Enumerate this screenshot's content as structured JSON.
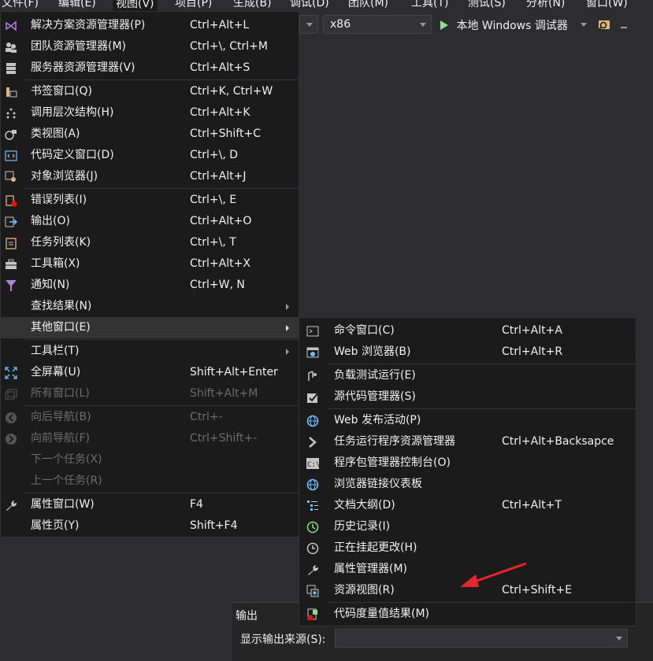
{
  "menubar": {
    "items": [
      "文件(F)",
      "编辑(E)",
      "视图(V)",
      "项目(P)",
      "生成(B)",
      "调试(D)",
      "团队(M)",
      "工具(T)",
      "测试(S)",
      "分析(N)",
      "窗口(W)"
    ]
  },
  "toolbar": {
    "config_value": "",
    "platform_value": "x86",
    "debug_label": "本地 Windows 调试器"
  },
  "view_menu": {
    "items": [
      {
        "label": "解决方案资源管理器(P)",
        "shortcut": "Ctrl+Alt+L",
        "icon": "solution-explorer-icon"
      },
      {
        "label": "团队资源管理器(M)",
        "shortcut": "Ctrl+\\, Ctrl+M",
        "icon": "team-explorer-icon"
      },
      {
        "label": "服务器资源管理器(V)",
        "shortcut": "Ctrl+Alt+S",
        "icon": "server-explorer-icon"
      },
      {
        "label": "书签窗口(Q)",
        "shortcut": "Ctrl+K, Ctrl+W",
        "icon": "bookmark-icon"
      },
      {
        "label": "调用层次结构(H)",
        "shortcut": "Ctrl+Alt+K",
        "icon": "call-hierarchy-icon"
      },
      {
        "label": "类视图(A)",
        "shortcut": "Ctrl+Shift+C",
        "icon": "class-view-icon"
      },
      {
        "label": "代码定义窗口(D)",
        "shortcut": "Ctrl+\\, D",
        "icon": "code-definition-icon"
      },
      {
        "label": "对象浏览器(J)",
        "shortcut": "Ctrl+Alt+J",
        "icon": "object-browser-icon"
      },
      {
        "label": "错误列表(I)",
        "shortcut": "Ctrl+\\, E",
        "icon": "error-list-icon"
      },
      {
        "label": "输出(O)",
        "shortcut": "Ctrl+Alt+O",
        "icon": "output-icon"
      },
      {
        "label": "任务列表(K)",
        "shortcut": "Ctrl+\\, T",
        "icon": "task-list-icon"
      },
      {
        "label": "工具箱(X)",
        "shortcut": "Ctrl+Alt+X",
        "icon": "toolbox-icon"
      },
      {
        "label": "通知(N)",
        "shortcut": "Ctrl+W, N",
        "icon": "notification-icon"
      },
      {
        "label": "查找结果(N)",
        "shortcut": "",
        "icon": ""
      },
      {
        "label": "其他窗口(E)",
        "shortcut": "",
        "icon": ""
      },
      {
        "label": "工具栏(T)",
        "shortcut": "",
        "icon": ""
      },
      {
        "label": "全屏幕(U)",
        "shortcut": "Shift+Alt+Enter",
        "icon": "fullscreen-icon"
      },
      {
        "label": "所有窗口(L)",
        "shortcut": "Shift+Alt+M",
        "icon": "all-windows-icon"
      },
      {
        "label": "向后导航(B)",
        "shortcut": "Ctrl+-",
        "icon": "navigate-back-icon"
      },
      {
        "label": "向前导航(F)",
        "shortcut": "Ctrl+Shift+-",
        "icon": "navigate-forward-icon"
      },
      {
        "label": "下一个任务(X)",
        "shortcut": "",
        "icon": ""
      },
      {
        "label": "上一个任务(R)",
        "shortcut": "",
        "icon": ""
      },
      {
        "label": "属性窗口(W)",
        "shortcut": "F4",
        "icon": "wrench-icon"
      },
      {
        "label": "属性页(Y)",
        "shortcut": "Shift+F4",
        "icon": ""
      }
    ]
  },
  "other_windows_menu": {
    "items": [
      {
        "label": "命令窗口(C)",
        "shortcut": "Ctrl+Alt+A",
        "icon": "command-window-icon"
      },
      {
        "label": "Web 浏览器(B)",
        "shortcut": "Ctrl+Alt+R",
        "icon": "web-browser-icon"
      },
      {
        "label": "负载测试运行(E)",
        "shortcut": "",
        "icon": "load-test-icon"
      },
      {
        "label": "源代码管理器(S)",
        "shortcut": "",
        "icon": "source-control-icon"
      },
      {
        "label": "Web 发布活动(P)",
        "shortcut": "",
        "icon": "web-publish-icon"
      },
      {
        "label": "任务运行程序资源管理器",
        "shortcut": "Ctrl+Alt+Backsapce",
        "icon": "task-runner-icon"
      },
      {
        "label": "程序包管理器控制台(O)",
        "shortcut": "",
        "icon": "package-manager-icon"
      },
      {
        "label": "浏览器链接仪表板",
        "shortcut": "",
        "icon": "browser-link-icon"
      },
      {
        "label": "文档大纲(D)",
        "shortcut": "Ctrl+Alt+T",
        "icon": "document-outline-icon"
      },
      {
        "label": "历史记录(I)",
        "shortcut": "",
        "icon": "history-icon"
      },
      {
        "label": "正在挂起更改(H)",
        "shortcut": "",
        "icon": "pending-changes-icon"
      },
      {
        "label": "属性管理器(M)",
        "shortcut": "",
        "icon": "property-manager-icon"
      },
      {
        "label": "资源视图(R)",
        "shortcut": "Ctrl+Shift+E",
        "icon": "resource-view-icon"
      },
      {
        "label": "代码度量值结果(M)",
        "shortcut": "",
        "icon": "code-metrics-icon"
      }
    ]
  },
  "output_panel": {
    "title": "输出",
    "source_label": "显示输出来源(S):",
    "source_value": ""
  },
  "colors": {
    "menu_bg": "#1b1b1c",
    "highlight": "#333334",
    "text": "#f1f1f1",
    "disabled": "#6d6d6d",
    "accent_blue": "#75beff",
    "annotation_red": "#e8242f"
  }
}
